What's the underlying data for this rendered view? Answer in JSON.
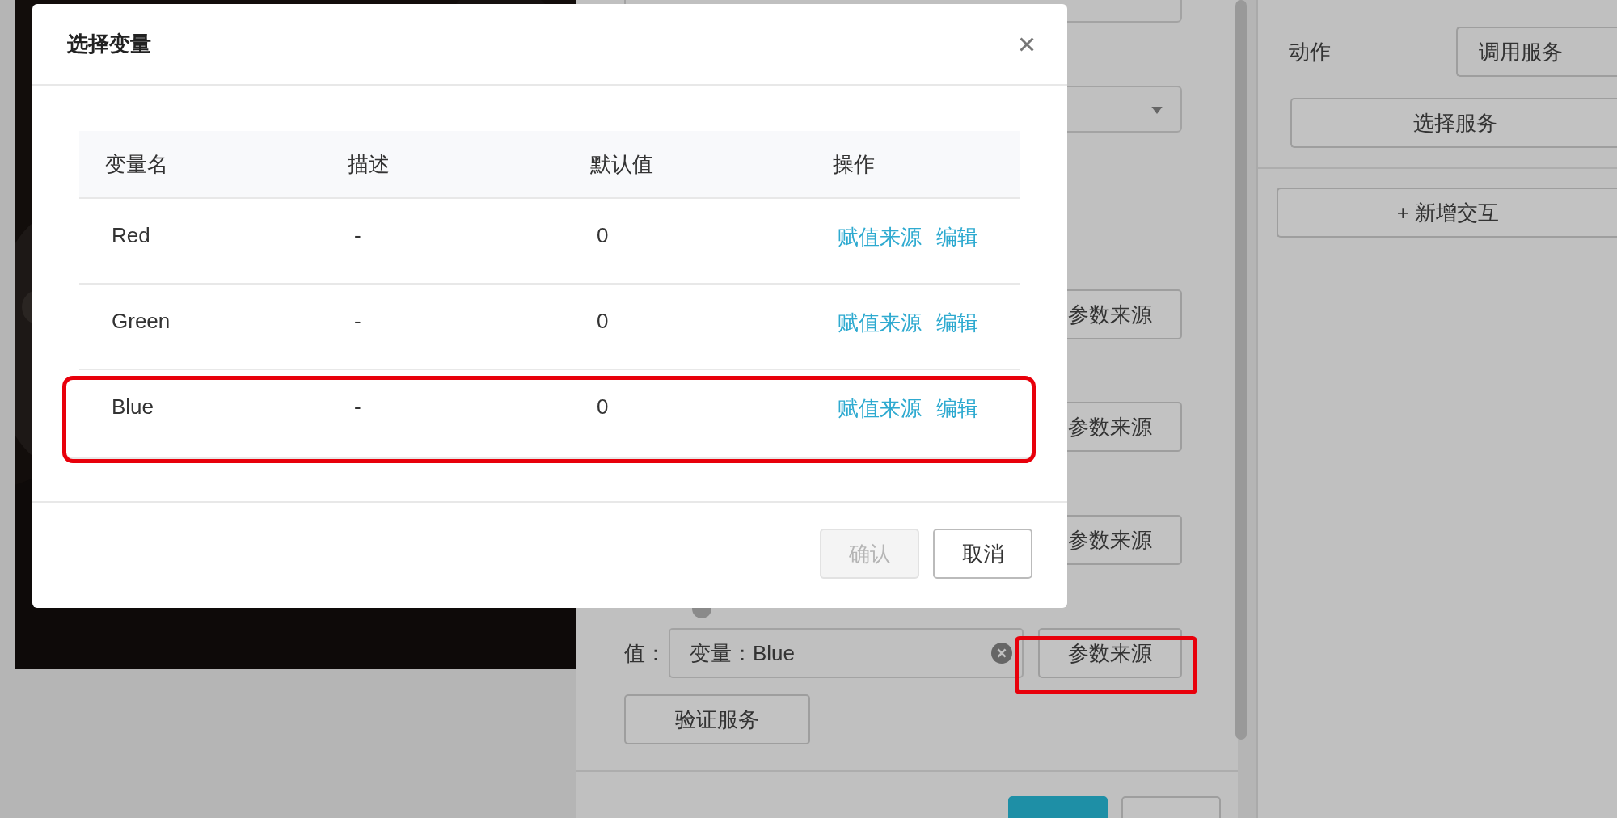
{
  "background": {
    "form": {
      "source_buttons": [
        {
          "label": "参数来源",
          "highlighted": false
        },
        {
          "label": "参数来源",
          "highlighted": false
        },
        {
          "label": "参数来源",
          "highlighted": false
        },
        {
          "label": "参数来源",
          "highlighted": true
        }
      ],
      "value_label": "值：",
      "value": "变量：Blue",
      "verify_button": "验证服务"
    },
    "side": {
      "action_label": "动作",
      "action_value": "调用服务",
      "select_service": "选择服务",
      "add_interaction": "+ 新增交互"
    }
  },
  "dialog": {
    "title": "选择变量",
    "columns": [
      "变量名",
      "描述",
      "默认值",
      "操作"
    ],
    "rows": [
      {
        "name": "Red",
        "description": "-",
        "default": "0",
        "actions": [
          "赋值来源",
          "编辑"
        ],
        "highlighted": false
      },
      {
        "name": "Green",
        "description": "-",
        "default": "0",
        "actions": [
          "赋值来源",
          "编辑"
        ],
        "highlighted": false
      },
      {
        "name": "Blue",
        "description": "-",
        "default": "0",
        "actions": [
          "赋值来源",
          "编辑"
        ],
        "highlighted": true
      }
    ],
    "buttons": [
      {
        "label": "确认",
        "disabled": true
      },
      {
        "label": "取消",
        "disabled": false
      }
    ]
  }
}
